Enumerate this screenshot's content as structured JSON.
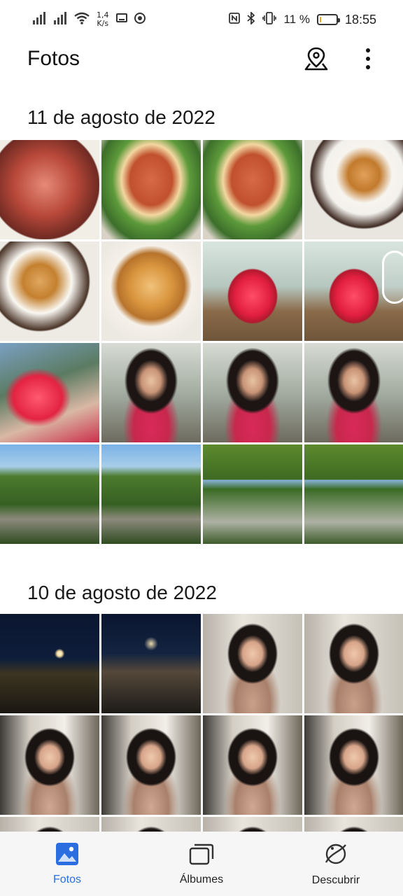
{
  "status_bar": {
    "speed_value": "1,4",
    "speed_unit": "K/s",
    "battery": "11 %",
    "battery_level": 0.11,
    "time": "18:55"
  },
  "app_bar": {
    "title": "Fotos",
    "icons": [
      "map-location-icon",
      "more-vert-icon"
    ]
  },
  "sections": [
    {
      "date": "11 de agosto de 2022",
      "photos": [
        "meat",
        "salmon",
        "salmon",
        "dessert1",
        "dessert2",
        "dessert3",
        "cocktail",
        "cocktail",
        "cocktail-hand",
        "woman",
        "woman",
        "woman",
        "trees",
        "trees",
        "trees2",
        "trees2"
      ]
    },
    {
      "date": "10 de agosto de 2022",
      "photos": [
        "night",
        "night2",
        "portrait",
        "portrait",
        "portrait2",
        "portrait2",
        "portrait2",
        "portrait2",
        "portrait",
        "portrait",
        "portrait",
        "portrait"
      ]
    }
  ],
  "bottom_nav": {
    "items": [
      {
        "label": "Fotos",
        "icon": "photo-icon",
        "active": true
      },
      {
        "label": "Álbumes",
        "icon": "albums-icon",
        "active": false
      },
      {
        "label": "Descubrir",
        "icon": "discover-icon",
        "active": false
      }
    ],
    "active_color": "#2a6ee0"
  }
}
